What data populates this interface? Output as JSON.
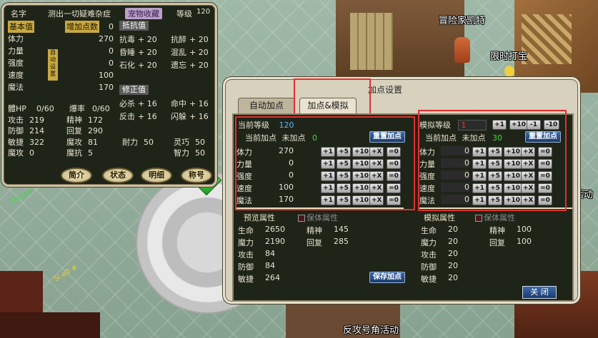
{
  "world": {
    "labels": {
      "npc_adventurer": "冒险家凯特",
      "npc_timed": "限时打宝",
      "npc_activity_right": "活动",
      "npc_activity_bottom": "反攻号角活动"
    },
    "floor_text_green": "Fav.aei",
    "floor_text_yellow": "Si.e0 #"
  },
  "character": {
    "name_label": "名字",
    "title_text": "测出一切疑难杂症",
    "collect_tag": "宠物收藏",
    "level_label": "等级",
    "level_value": "120",
    "basic_label": "基本值",
    "bonus_label": "增加点数",
    "bonus_value": "0",
    "base_stats": [
      {
        "label": "体力",
        "value": "270"
      },
      {
        "label": "力量",
        "value": "0"
      },
      {
        "label": "强度",
        "value": "0"
      },
      {
        "label": "速度",
        "value": "100"
      },
      {
        "label": "魔法",
        "value": "170"
      }
    ],
    "resist_title": "抵抗值",
    "resists": [
      [
        {
          "label": "抗毒",
          "value": "+ 20"
        },
        {
          "label": "抗醉",
          "value": "+ 20"
        }
      ],
      [
        {
          "label": "昏睡",
          "value": "+ 20"
        },
        {
          "label": "混乱",
          "value": "+ 20"
        }
      ],
      [
        {
          "label": "石化",
          "value": "+ 20"
        },
        {
          "label": "遗忘",
          "value": "+ 20"
        }
      ]
    ],
    "modify_title": "修正值",
    "modifies": [
      [
        {
          "label": "必杀",
          "value": "+ 16"
        },
        {
          "label": "命中",
          "value": "+ 16"
        }
      ],
      [
        {
          "label": "反击",
          "value": "+ 16"
        },
        {
          "label": "闪躲",
          "value": "+ 16"
        }
      ]
    ],
    "hp_label": "體HP",
    "hp_value": "0/60",
    "burst_label": "爆率",
    "burst_value": "0/60",
    "derived": [
      [
        {
          "label": "攻击",
          "value": "219"
        },
        {
          "label": "精神",
          "value": "172"
        }
      ],
      [
        {
          "label": "防御",
          "value": "214"
        },
        {
          "label": "回复",
          "value": "290"
        }
      ],
      [
        {
          "label": "敏捷",
          "value": "322"
        },
        {
          "label": "魔攻",
          "value": "81"
        },
        {
          "label": "耐力",
          "value": "50"
        },
        {
          "label": "灵巧",
          "value": "50"
        }
      ],
      [
        {
          "label": "魔攻",
          "value": "0"
        },
        {
          "label": "魔抗",
          "value": "5"
        },
        {
          "label": "",
          "value": ""
        },
        {
          "label": "智力",
          "value": "50"
        }
      ]
    ],
    "tabs": [
      "简介",
      "状态",
      "明细",
      "称号"
    ],
    "vertical_note": "自动设置"
  },
  "alloc": {
    "title": "加点设置",
    "tabs": [
      "自动加点",
      "加点&模拟"
    ],
    "left": {
      "level_label": "当前等级",
      "level_value": "120",
      "points_label": "当前加点",
      "points_text": "未加点",
      "points_value": "0",
      "reset_label": "重置加点",
      "attrs": [
        {
          "label": "体力",
          "value": "270"
        },
        {
          "label": "力量",
          "value": "0"
        },
        {
          "label": "强度",
          "value": "0"
        },
        {
          "label": "速度",
          "value": "100"
        },
        {
          "label": "魔法",
          "value": "170"
        }
      ],
      "preview_label": "预览属性",
      "actual_label": "保体属性",
      "preview_stats": [
        [
          {
            "label": "生命",
            "value": "2650"
          },
          {
            "label": "精神",
            "value": "145"
          }
        ],
        [
          {
            "label": "魔力",
            "value": "2190"
          },
          {
            "label": "回复",
            "value": "285"
          }
        ],
        [
          {
            "label": "攻击",
            "value": "84"
          }
        ],
        [
          {
            "label": "防御",
            "value": "84"
          }
        ],
        [
          {
            "label": "敏捷",
            "value": "264"
          }
        ]
      ],
      "save_label": "保存加点"
    },
    "right": {
      "level_label": "模拟等级",
      "level_value": "1",
      "level_buttons": [
        "+1",
        "+10",
        "-1",
        "-10"
      ],
      "points_label": "当前加点",
      "points_text": "未加点",
      "points_value": "30",
      "reset_label": "重置加点",
      "attrs": [
        {
          "label": "体力",
          "value": "0"
        },
        {
          "label": "力量",
          "value": "0"
        },
        {
          "label": "强度",
          "value": "0"
        },
        {
          "label": "速度",
          "value": "0"
        },
        {
          "label": "魔法",
          "value": "0"
        }
      ],
      "preview_label": "模拟属性",
      "actual_label": "保体属性",
      "preview_stats": [
        [
          {
            "label": "生命",
            "value": "20"
          },
          {
            "label": "精神",
            "value": "100"
          }
        ],
        [
          {
            "label": "魔力",
            "value": "20"
          },
          {
            "label": "回复",
            "value": "100"
          }
        ],
        [
          {
            "label": "攻击",
            "value": "20"
          }
        ],
        [
          {
            "label": "防御",
            "value": "20"
          }
        ],
        [
          {
            "label": "敏捷",
            "value": "20"
          }
        ]
      ]
    },
    "step_buttons": [
      "+1",
      "+5",
      "+10",
      "+X",
      "=0"
    ],
    "close_label": "关 闭"
  },
  "colors": {
    "highlight": "#e23030",
    "value_green": "#3fdc3f",
    "value_blue": "#5fb4ff",
    "value_red": "#ff3030"
  }
}
